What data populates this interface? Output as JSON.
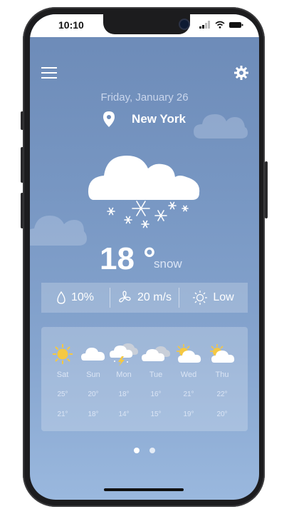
{
  "status_bar": {
    "time": "10:10"
  },
  "header": {
    "menu_icon": "hamburger-menu-icon",
    "settings_icon": "gear-icon",
    "date": "Friday, January 26",
    "location": "New York"
  },
  "current": {
    "icon": "snow-cloud-icon",
    "temperature": "18 °",
    "condition": "snow"
  },
  "stats": {
    "humidity": {
      "icon": "drop-icon",
      "value": "10%"
    },
    "wind": {
      "icon": "fan-icon",
      "value": "20 m/s"
    },
    "uv": {
      "icon": "sun-outline-icon",
      "value": "Low"
    }
  },
  "forecast": [
    {
      "day": "Sat",
      "icon": "sun-icon",
      "high": "25°",
      "low": "21°"
    },
    {
      "day": "Sun",
      "icon": "cloud-icon",
      "high": "20°",
      "low": "18°"
    },
    {
      "day": "Mon",
      "icon": "thunderstorm-icon",
      "high": "18°",
      "low": "14°"
    },
    {
      "day": "Tue",
      "icon": "clouds-icon",
      "high": "16°",
      "low": "15°"
    },
    {
      "day": "Wed",
      "icon": "partly-sunny-icon",
      "high": "21°",
      "low": "19°"
    },
    {
      "day": "Thu",
      "icon": "partly-sunny-icon",
      "high": "22°",
      "low": "20°"
    }
  ],
  "pager": {
    "pages": 2,
    "active": 1
  },
  "colors": {
    "sky_top": "#6c8ab7",
    "sky_bottom": "#9ab8de",
    "sun": "#f5c842"
  }
}
